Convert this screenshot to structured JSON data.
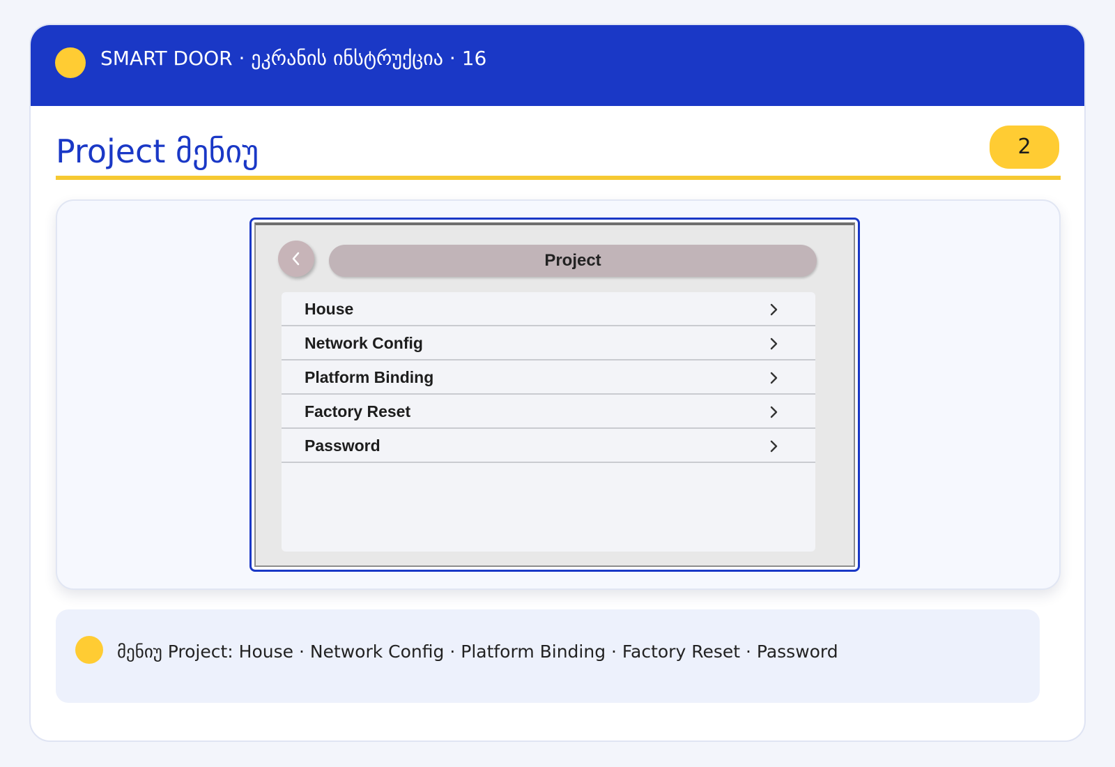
{
  "header": {
    "title": "SMART DOOR · ეკრანის ინსტრუქცია · 16"
  },
  "page": {
    "title": "Project მენიუ",
    "badge": "2"
  },
  "device": {
    "title": "Project",
    "back_icon": "chevron-left-icon",
    "menu_items": [
      {
        "label": "House",
        "icon": "chevron-right-icon"
      },
      {
        "label": "Network Config",
        "icon": "chevron-right-icon"
      },
      {
        "label": "Platform Binding",
        "icon": "chevron-right-icon"
      },
      {
        "label": "Factory Reset",
        "icon": "chevron-right-icon"
      },
      {
        "label": "Password",
        "icon": "chevron-right-icon"
      }
    ]
  },
  "info": {
    "text": "მენიუ Project: House · Network Config · Platform Binding · Factory Reset · Password"
  },
  "colors": {
    "brand_blue": "#1a38c6",
    "accent_yellow": "#ffcc33",
    "divider_yellow": "#f6c932"
  }
}
